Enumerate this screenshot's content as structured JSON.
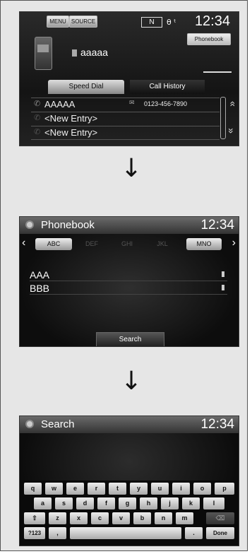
{
  "screen1": {
    "menu_label": "MENU",
    "source_label": "SOURCE",
    "gear_indicator": "N",
    "status_icons": "θ ᵗ",
    "time": "12:34",
    "phonebook_label": "Phonebook",
    "device_name": "aaaaa",
    "tabs": [
      "Speed Dial",
      "Call History"
    ],
    "rows": [
      {
        "name": "AAAAA",
        "number": "0123-456-7890"
      },
      {
        "name": "<New Entry>",
        "number": ""
      },
      {
        "name": "<New Entry>",
        "number": ""
      }
    ],
    "up_glyph": "»",
    "down_glyph": "»"
  },
  "arrow": "↓",
  "screen2": {
    "title": "Phonebook",
    "time": "12:34",
    "tabs": [
      "ABC",
      "DEF",
      "GHI",
      "JKL",
      "MNO"
    ],
    "prev": "‹",
    "next": "›",
    "entries": [
      "AAA",
      "BBB"
    ],
    "search_label": "Search"
  },
  "screen3": {
    "title": "Search",
    "time": "12:34",
    "row1": [
      "q",
      "w",
      "e",
      "r",
      "t",
      "y",
      "u",
      "i",
      "o",
      "p"
    ],
    "row2": [
      "a",
      "s",
      "d",
      "f",
      "g",
      "h",
      "j",
      "k",
      "l"
    ],
    "row3_shift": "⇧",
    "row3": [
      "z",
      "x",
      "c",
      "v",
      "b",
      "n",
      "m"
    ],
    "row3_backspace": "⌫",
    "row4_symbols": "?123",
    "row4_comma": ",",
    "row4_period": ".",
    "row4_done": "Done"
  }
}
